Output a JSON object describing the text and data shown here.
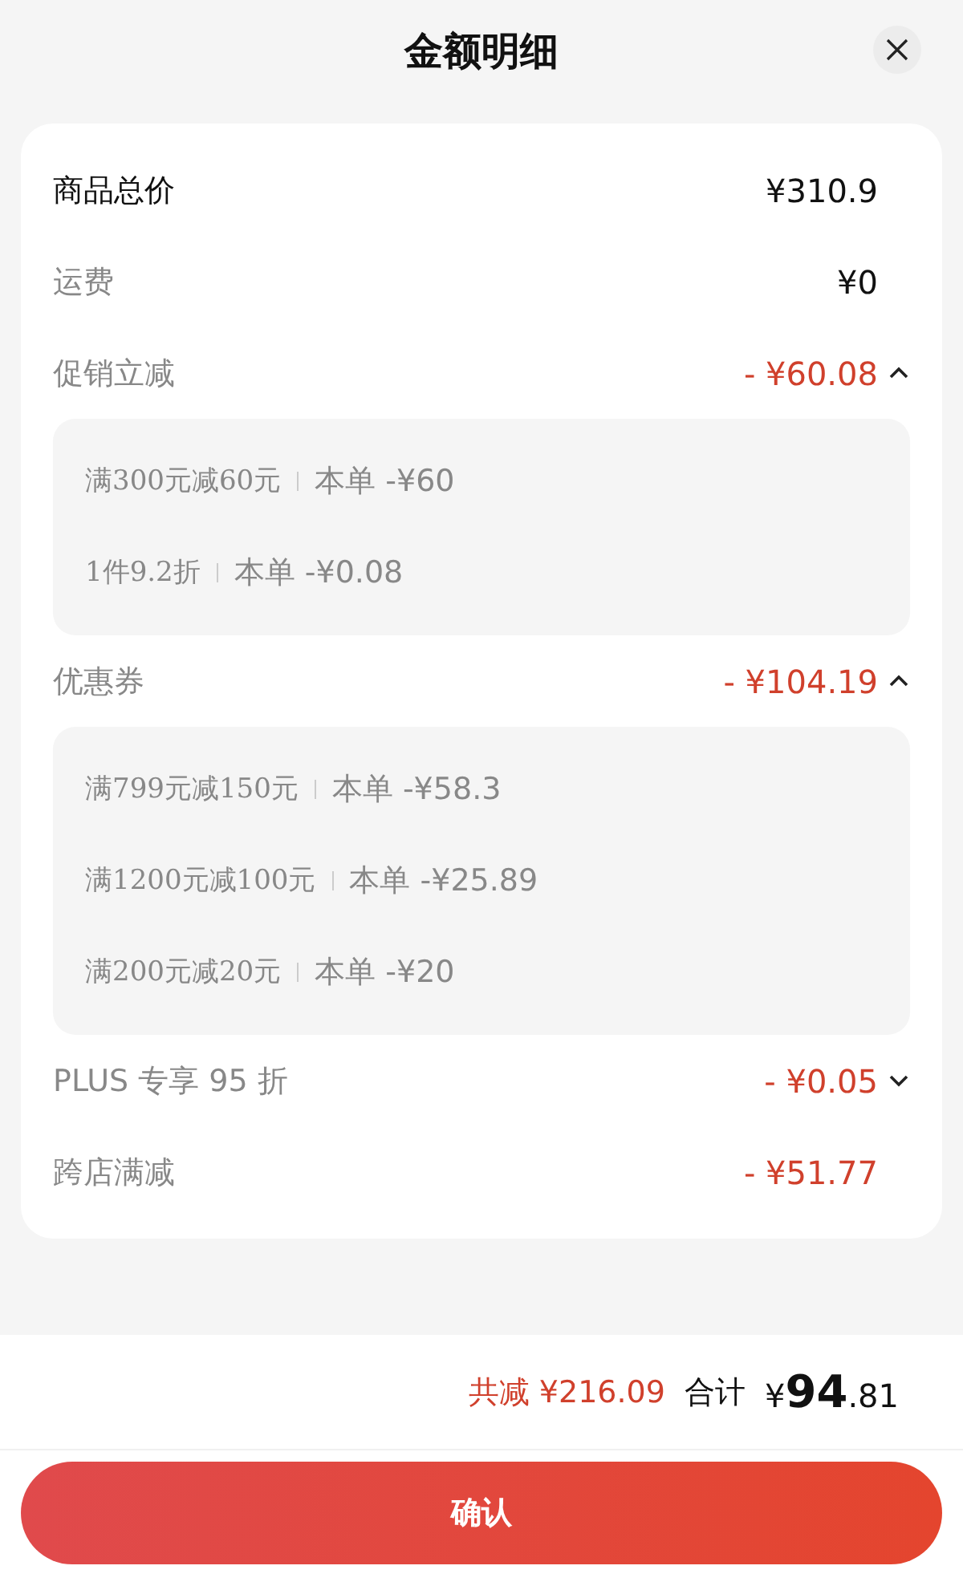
{
  "title": "金额明细",
  "rows": [
    {
      "kind": "total",
      "label": "商品总价",
      "amount": "¥310.9"
    },
    {
      "kind": "plain",
      "label": "运费",
      "amount": "¥0"
    },
    {
      "kind": "discount",
      "label": "促销立减",
      "amount": "- ¥60.08",
      "expanded": true,
      "details": [
        {
          "rule": "满300元减60元",
          "amount": "本单 -¥60"
        },
        {
          "rule": "1件9.2折",
          "amount": "本单 -¥0.08"
        }
      ]
    },
    {
      "kind": "discount",
      "label": "优惠券",
      "amount": "- ¥104.19",
      "expanded": true,
      "details": [
        {
          "rule": "满799元减150元",
          "amount": "本单 -¥58.3"
        },
        {
          "rule": "满1200元减100元",
          "amount": "本单 -¥25.89"
        },
        {
          "rule": "满200元减20元",
          "amount": "本单 -¥20"
        }
      ]
    },
    {
      "kind": "discount",
      "label": "PLUS 专享 95 折",
      "amount": "- ¥0.05",
      "expanded": false
    },
    {
      "kind": "discount",
      "label": "跨店满减",
      "amount": "- ¥51.77"
    }
  ],
  "summary": {
    "saved_label": "共减",
    "saved": "¥216.09",
    "total_label": "合计",
    "total": "¥**94**.81"
  },
  "button": "确认"
}
